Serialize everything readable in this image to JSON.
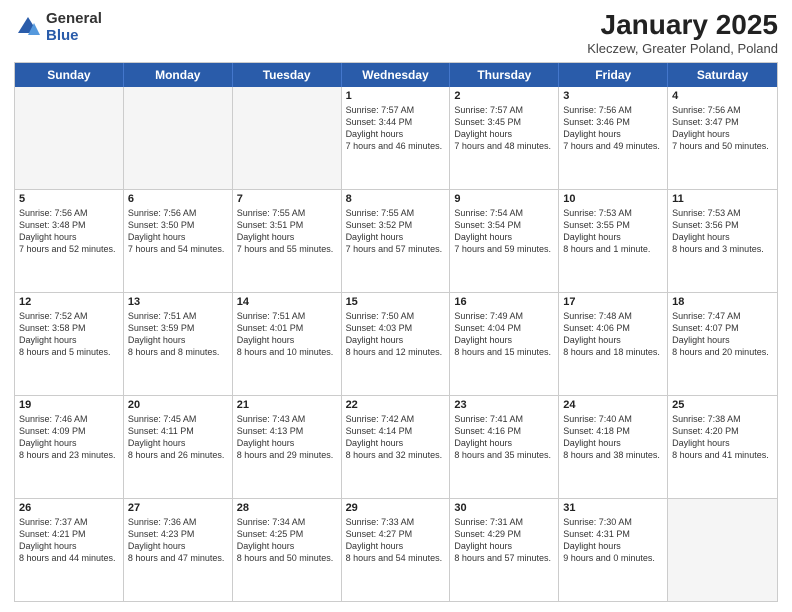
{
  "header": {
    "logo": {
      "general": "General",
      "blue": "Blue"
    },
    "title": "January 2025",
    "subtitle": "Kleczew, Greater Poland, Poland"
  },
  "dayHeaders": [
    "Sunday",
    "Monday",
    "Tuesday",
    "Wednesday",
    "Thursday",
    "Friday",
    "Saturday"
  ],
  "weeks": [
    [
      {
        "day": "",
        "empty": true
      },
      {
        "day": "",
        "empty": true
      },
      {
        "day": "",
        "empty": true
      },
      {
        "day": "1",
        "sunrise": "7:57 AM",
        "sunset": "3:44 PM",
        "daylight": "7 hours and 46 minutes."
      },
      {
        "day": "2",
        "sunrise": "7:57 AM",
        "sunset": "3:45 PM",
        "daylight": "7 hours and 48 minutes."
      },
      {
        "day": "3",
        "sunrise": "7:56 AM",
        "sunset": "3:46 PM",
        "daylight": "7 hours and 49 minutes."
      },
      {
        "day": "4",
        "sunrise": "7:56 AM",
        "sunset": "3:47 PM",
        "daylight": "7 hours and 50 minutes."
      }
    ],
    [
      {
        "day": "5",
        "sunrise": "7:56 AM",
        "sunset": "3:48 PM",
        "daylight": "7 hours and 52 minutes."
      },
      {
        "day": "6",
        "sunrise": "7:56 AM",
        "sunset": "3:50 PM",
        "daylight": "7 hours and 54 minutes."
      },
      {
        "day": "7",
        "sunrise": "7:55 AM",
        "sunset": "3:51 PM",
        "daylight": "7 hours and 55 minutes."
      },
      {
        "day": "8",
        "sunrise": "7:55 AM",
        "sunset": "3:52 PM",
        "daylight": "7 hours and 57 minutes."
      },
      {
        "day": "9",
        "sunrise": "7:54 AM",
        "sunset": "3:54 PM",
        "daylight": "7 hours and 59 minutes."
      },
      {
        "day": "10",
        "sunrise": "7:53 AM",
        "sunset": "3:55 PM",
        "daylight": "8 hours and 1 minute."
      },
      {
        "day": "11",
        "sunrise": "7:53 AM",
        "sunset": "3:56 PM",
        "daylight": "8 hours and 3 minutes."
      }
    ],
    [
      {
        "day": "12",
        "sunrise": "7:52 AM",
        "sunset": "3:58 PM",
        "daylight": "8 hours and 5 minutes."
      },
      {
        "day": "13",
        "sunrise": "7:51 AM",
        "sunset": "3:59 PM",
        "daylight": "8 hours and 8 minutes."
      },
      {
        "day": "14",
        "sunrise": "7:51 AM",
        "sunset": "4:01 PM",
        "daylight": "8 hours and 10 minutes."
      },
      {
        "day": "15",
        "sunrise": "7:50 AM",
        "sunset": "4:03 PM",
        "daylight": "8 hours and 12 minutes."
      },
      {
        "day": "16",
        "sunrise": "7:49 AM",
        "sunset": "4:04 PM",
        "daylight": "8 hours and 15 minutes."
      },
      {
        "day": "17",
        "sunrise": "7:48 AM",
        "sunset": "4:06 PM",
        "daylight": "8 hours and 18 minutes."
      },
      {
        "day": "18",
        "sunrise": "7:47 AM",
        "sunset": "4:07 PM",
        "daylight": "8 hours and 20 minutes."
      }
    ],
    [
      {
        "day": "19",
        "sunrise": "7:46 AM",
        "sunset": "4:09 PM",
        "daylight": "8 hours and 23 minutes."
      },
      {
        "day": "20",
        "sunrise": "7:45 AM",
        "sunset": "4:11 PM",
        "daylight": "8 hours and 26 minutes."
      },
      {
        "day": "21",
        "sunrise": "7:43 AM",
        "sunset": "4:13 PM",
        "daylight": "8 hours and 29 minutes."
      },
      {
        "day": "22",
        "sunrise": "7:42 AM",
        "sunset": "4:14 PM",
        "daylight": "8 hours and 32 minutes."
      },
      {
        "day": "23",
        "sunrise": "7:41 AM",
        "sunset": "4:16 PM",
        "daylight": "8 hours and 35 minutes."
      },
      {
        "day": "24",
        "sunrise": "7:40 AM",
        "sunset": "4:18 PM",
        "daylight": "8 hours and 38 minutes."
      },
      {
        "day": "25",
        "sunrise": "7:38 AM",
        "sunset": "4:20 PM",
        "daylight": "8 hours and 41 minutes."
      }
    ],
    [
      {
        "day": "26",
        "sunrise": "7:37 AM",
        "sunset": "4:21 PM",
        "daylight": "8 hours and 44 minutes."
      },
      {
        "day": "27",
        "sunrise": "7:36 AM",
        "sunset": "4:23 PM",
        "daylight": "8 hours and 47 minutes."
      },
      {
        "day": "28",
        "sunrise": "7:34 AM",
        "sunset": "4:25 PM",
        "daylight": "8 hours and 50 minutes."
      },
      {
        "day": "29",
        "sunrise": "7:33 AM",
        "sunset": "4:27 PM",
        "daylight": "8 hours and 54 minutes."
      },
      {
        "day": "30",
        "sunrise": "7:31 AM",
        "sunset": "4:29 PM",
        "daylight": "8 hours and 57 minutes."
      },
      {
        "day": "31",
        "sunrise": "7:30 AM",
        "sunset": "4:31 PM",
        "daylight": "9 hours and 0 minutes."
      },
      {
        "day": "",
        "empty": true
      }
    ]
  ],
  "labels": {
    "sunrise": "Sunrise:",
    "sunset": "Sunset:",
    "daylight": "Daylight hours"
  }
}
